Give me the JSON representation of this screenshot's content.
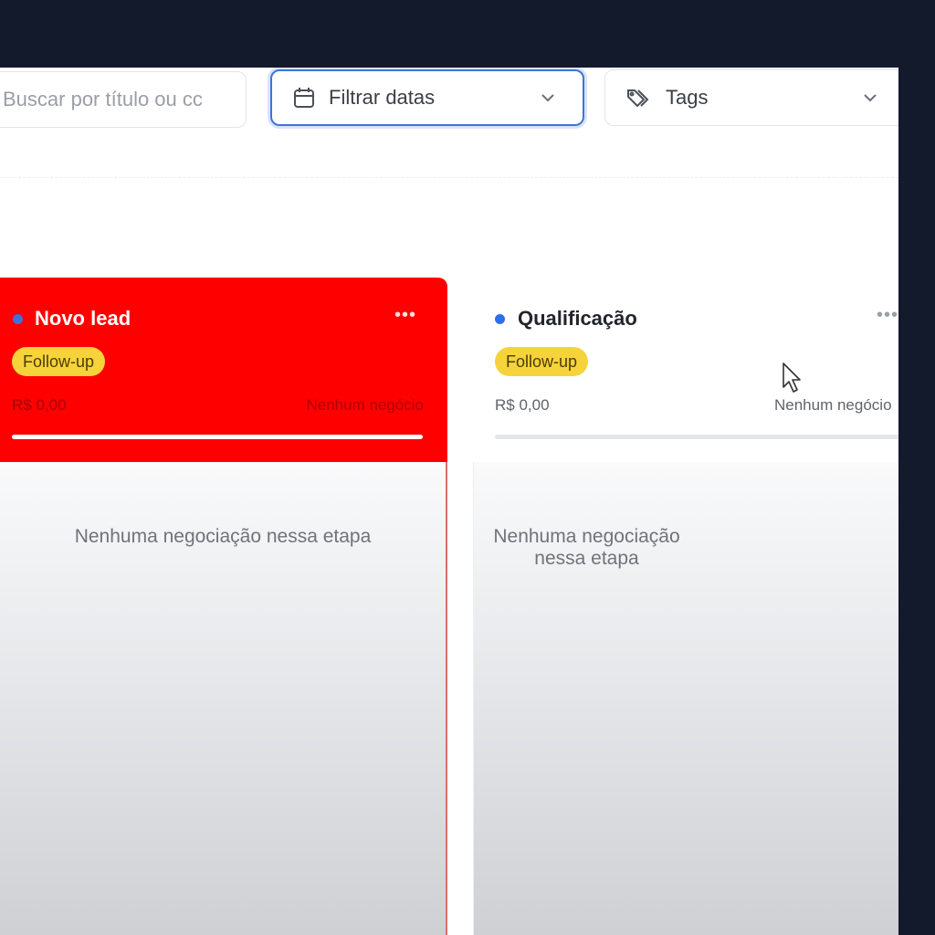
{
  "search": {
    "placeholder": "Buscar por título ou cc"
  },
  "filters": {
    "dates": {
      "label": "Filtrar datas",
      "icon": "calendar-icon"
    },
    "tags": {
      "label": "Tags",
      "icon": "tag-icon"
    }
  },
  "columns": [
    {
      "title": "Novo lead",
      "tag": "Follow-up",
      "amount": "R$ 0,00",
      "count": "Nenhum negócio",
      "empty": "Nenhuma negociação nessa etapa",
      "header_color": "#fe0000",
      "dot_color": "#3f6fe0"
    },
    {
      "title": "Qualificação",
      "tag": "Follow-up",
      "amount": "R$ 0,00",
      "count": "Nenhum negócio",
      "empty": "Nenhuma negociação nessa etapa",
      "header_color": "#ffffff",
      "dot_color": "#2d6fe6"
    }
  ],
  "colors": {
    "backdrop": "#131a2c",
    "accent": "#3c74d6",
    "tag": "#f6d33a"
  }
}
